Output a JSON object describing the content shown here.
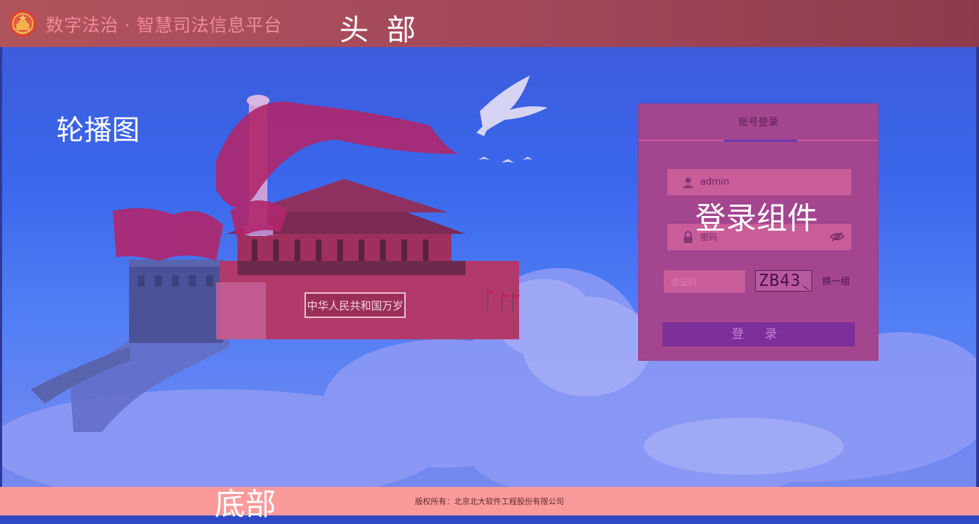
{
  "header": {
    "title": "数字法治 · 智慧司法信息平台",
    "annotation": "头 部"
  },
  "carousel": {
    "annotation": "轮播图",
    "banner_text": "中华人民共和国万岁"
  },
  "login": {
    "annotation": "登录组件",
    "tab_label": "账号登录",
    "username_value": "admin",
    "password_placeholder": "密码",
    "captcha_placeholder": "验证码",
    "captcha_text": "ZB43",
    "refresh_label": "换一组",
    "submit_label": "登 录"
  },
  "footer": {
    "annotation": "底部",
    "copyright": "版权所有：北京北大软件工程股份有限公司"
  },
  "colors": {
    "header_bg": "#a1475a",
    "stage_bg": "#3a67ec",
    "login_panel": "#a4468f",
    "login_button": "#7c2f98",
    "footer_bg": "#fb9a9a"
  }
}
